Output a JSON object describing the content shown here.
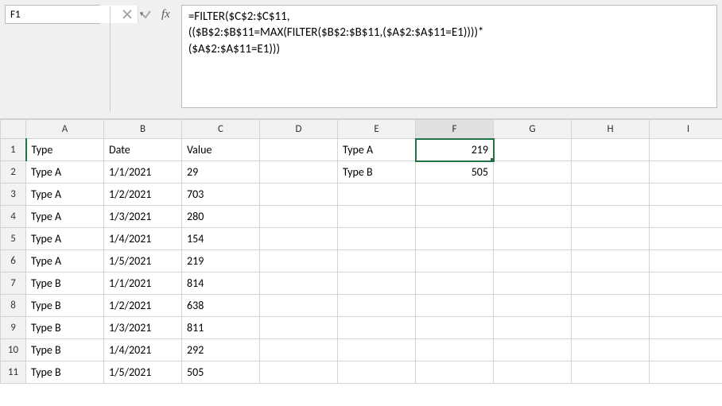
{
  "namebox": {
    "value": "F1"
  },
  "formula_bar": {
    "text": "=FILTER($C$2:$C$11,\n(($B$2:$B$11=MAX(FILTER($B$2:$B$11,($A$2:$A$11=E1))))*\n($A$2:$A$11=E1)))"
  },
  "columns": [
    "A",
    "B",
    "C",
    "D",
    "E",
    "F",
    "G",
    "H",
    "I"
  ],
  "rows": [
    "1",
    "2",
    "3",
    "4",
    "5",
    "6",
    "7",
    "8",
    "9",
    "10",
    "11"
  ],
  "selected": {
    "row": 0,
    "col": 5
  },
  "headers": {
    "A": "Type",
    "B": "Date",
    "C": "Value"
  },
  "table": [
    {
      "type": "Type A",
      "date": "1/1/2021",
      "value": "29"
    },
    {
      "type": "Type A",
      "date": "1/2/2021",
      "value": "703"
    },
    {
      "type": "Type A",
      "date": "1/3/2021",
      "value": "280"
    },
    {
      "type": "Type A",
      "date": "1/4/2021",
      "value": "154"
    },
    {
      "type": "Type A",
      "date": "1/5/2021",
      "value": "219"
    },
    {
      "type": "Type B",
      "date": "1/1/2021",
      "value": "814"
    },
    {
      "type": "Type B",
      "date": "1/2/2021",
      "value": "638"
    },
    {
      "type": "Type B",
      "date": "1/3/2021",
      "value": "811"
    },
    {
      "type": "Type B",
      "date": "1/4/2021",
      "value": "292"
    },
    {
      "type": "Type B",
      "date": "1/5/2021",
      "value": "505"
    }
  ],
  "results": [
    {
      "label": "Type A",
      "value": "219"
    },
    {
      "label": "Type B",
      "value": "505"
    }
  ]
}
